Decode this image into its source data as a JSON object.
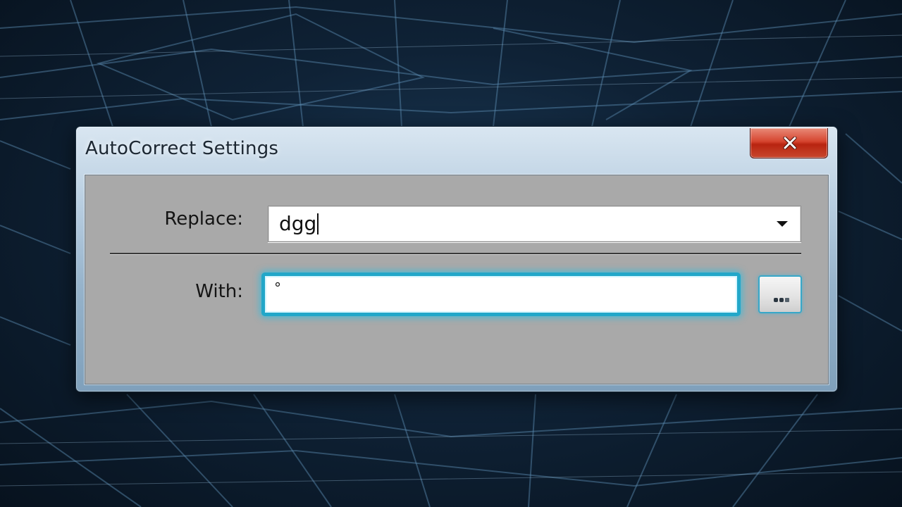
{
  "window": {
    "title": "AutoCorrect Settings",
    "close_icon": "close-icon"
  },
  "form": {
    "replace_label": "Replace:",
    "replace_value": "dgg",
    "with_label": "With:",
    "with_value": "°",
    "dropdown_icon": "chevron-down-icon",
    "special_button_icon": "insert-symbol-icon"
  },
  "colors": {
    "close_button": "#c8372a",
    "focus_ring": "#22a7c9",
    "client_background": "#a9a9a9"
  }
}
